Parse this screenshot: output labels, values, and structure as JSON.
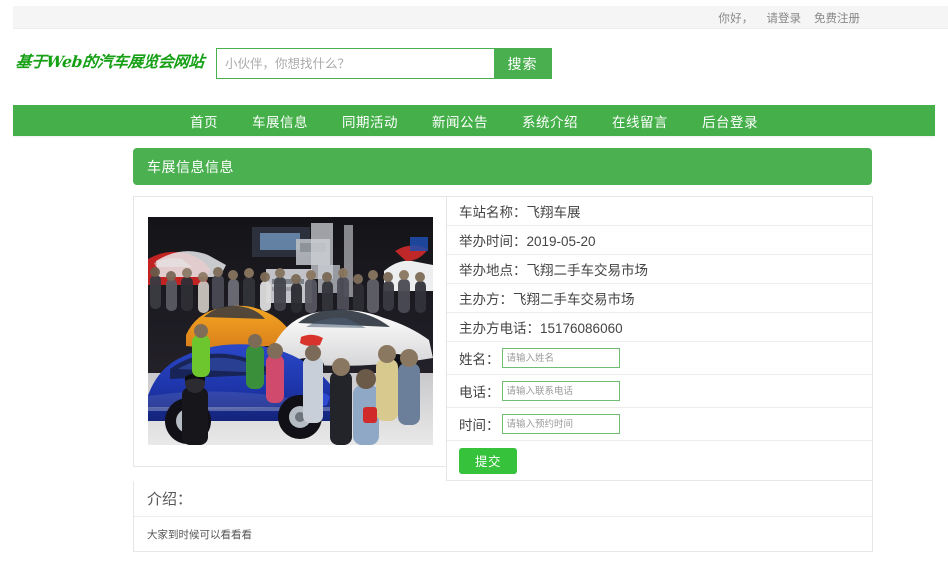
{
  "topbar": {
    "greeting": "你好，",
    "login_label": "请登录",
    "register_label": "免费注册"
  },
  "header": {
    "logo_text": "基于Web的汽车展览会网站",
    "search": {
      "placeholder": "小伙伴，你想找什么？",
      "value": "",
      "button_label": "搜索"
    }
  },
  "nav": {
    "items": [
      {
        "label": "首页",
        "name": "nav-item-home"
      },
      {
        "label": "车展信息",
        "name": "nav-item-autoshow-info"
      },
      {
        "label": "同期活动",
        "name": "nav-item-concurrent-events"
      },
      {
        "label": "新闻公告",
        "name": "nav-item-news"
      },
      {
        "label": "系统介绍",
        "name": "nav-item-system-intro"
      },
      {
        "label": "在线留言",
        "name": "nav-item-message-board"
      },
      {
        "label": "后台登录",
        "name": "nav-item-admin-login"
      }
    ]
  },
  "page": {
    "banner_title": "车展信息信息"
  },
  "detail": {
    "photo_alt": "车展现场照片",
    "rows": [
      {
        "label": "车站名称：",
        "value": "飞翔车展"
      },
      {
        "label": "举办时间：",
        "value": "2019-05-20"
      },
      {
        "label": "举办地点：",
        "value": "飞翔二手车交易市场"
      },
      {
        "label": "主办方：",
        "value": "飞翔二手车交易市场"
      },
      {
        "label": "主办方电话：",
        "value": "15176086060"
      }
    ],
    "row_texts": [
      "车站名称：飞翔车展",
      "举办时间：2019-05-20",
      "举办地点：飞翔二手车交易市场",
      "主办方：飞翔二手车交易市场",
      "主办方电话：15176086060"
    ]
  },
  "form": {
    "fields": [
      {
        "label": "姓名：",
        "placeholder": "请输入姓名",
        "value": ""
      },
      {
        "label": "电话：",
        "placeholder": "请输入联系电话",
        "value": ""
      },
      {
        "label": "时间：",
        "placeholder": "请输入预约时间",
        "value": ""
      }
    ],
    "submit_label": "提交"
  },
  "intro": {
    "title": "介绍：",
    "body": "大家到时候可以看看看"
  },
  "colors": {
    "brand_green": "#45b04a",
    "banner_green": "#4bb050",
    "button_green": "#36c23a",
    "logo_green": "#16a016",
    "topbar_bg": "#f5f5f5",
    "border_gray": "#e6e6e6"
  }
}
